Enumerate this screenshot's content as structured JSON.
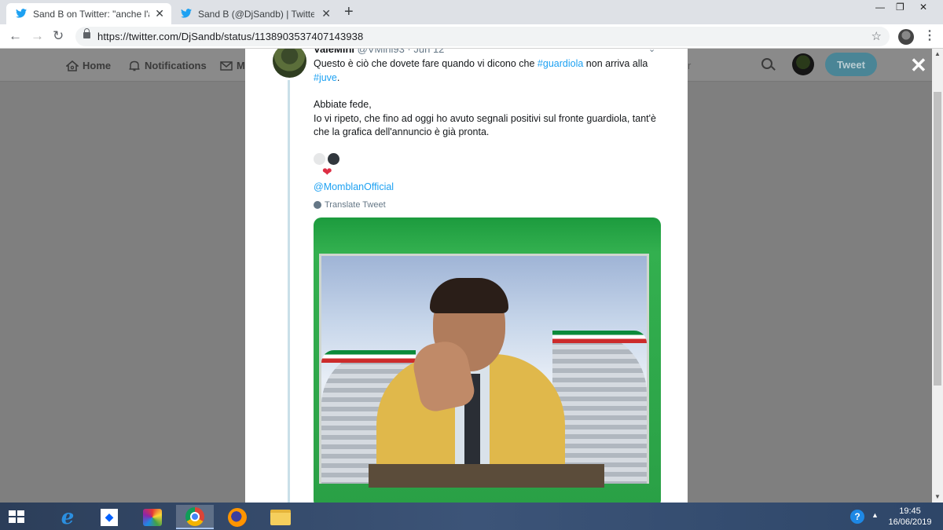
{
  "browser": {
    "tabs": [
      {
        "title": "Sand B on Twitter: \"anche l'avvis",
        "active": true
      },
      {
        "title": "Sand B (@DjSandb) | Twitter",
        "active": false
      }
    ],
    "new_tab": "+",
    "close_glyph": "✕",
    "window_controls": {
      "minimize": "—",
      "restore": "❐",
      "close": "✕"
    },
    "back": "←",
    "forward": "→",
    "reload": "↻",
    "url": "https://twitter.com/DjSandb/status/1138903537407143938",
    "bookmark": "☆",
    "menu": "⋮"
  },
  "twitter_header": {
    "home": "Home",
    "notifications": "Notifications",
    "messages_partial": "M",
    "search_partial": "r",
    "tweet_button": "Tweet",
    "overlay_close": "✕"
  },
  "tweet": {
    "name": "ValeMini",
    "handle": "@VMini93 · Jun 12",
    "chevron": "⌄",
    "line1_text": "Questo è ciò che dovete fare quando vi dicono che ",
    "line1_hashtag": "#guardiola",
    "line1_rest": " non arriva alla ",
    "line2_hashtag": "#juve",
    "line2_end": ".",
    "para2_l1": "Abbiate fede,",
    "para2_l2": "Io vi ripeto, che fino ad oggi ho avuto segnali positivi sul fronte guardiola, tant'è che la grafica dell'annuncio è già pronta.",
    "heart": "❤",
    "mention": "@MomblanOfficial",
    "translate": "Translate Tweet"
  },
  "taskbar": {
    "time": "19:45",
    "date": "16/06/2019",
    "help": "?",
    "caret": "▲",
    "ie_glyph": "e",
    "dropbox_glyph": "◆"
  },
  "colors": {
    "link": "#1da1f2",
    "twitter_button": "#4a8596",
    "taskbar": "#2c3e59"
  }
}
